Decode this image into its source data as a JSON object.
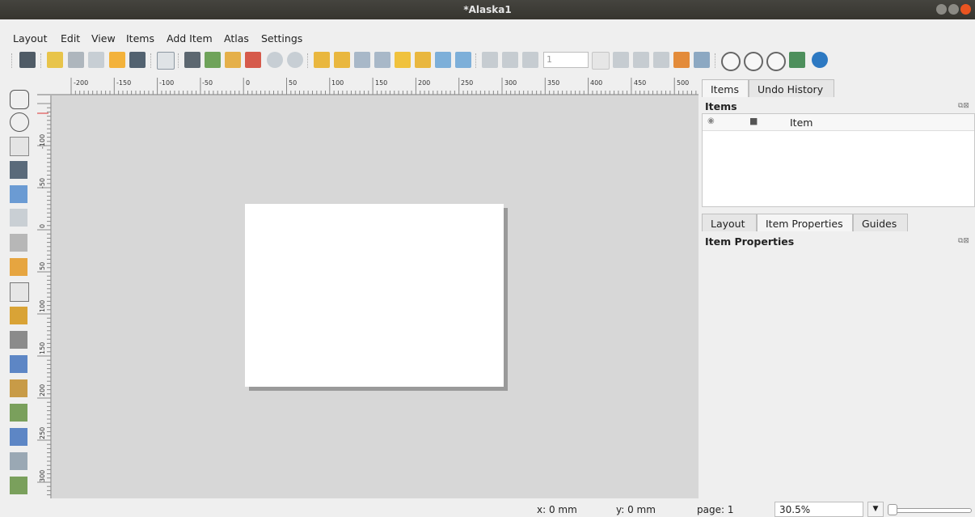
{
  "window": {
    "title": "*Alaska1"
  },
  "menu": {
    "items": [
      "Layout",
      "Edit",
      "View",
      "Items",
      "Add Item",
      "Atlas",
      "Settings"
    ]
  },
  "toolbar": {
    "page_number": "1",
    "icons": [
      "save-layout-icon",
      "new-layout-icon",
      "duplicate-layout-icon",
      "layout-manager-icon",
      "open-template-icon",
      "save-template-icon",
      "page-add-icon",
      "print-icon",
      "export-image-icon",
      "export-svg-icon",
      "export-pdf-icon",
      "undo-icon",
      "redo-icon",
      "group-icon",
      "ungroup-icon",
      "lock-icon",
      "unlock-icon",
      "raise-icon",
      "align-icon",
      "distribute-icon",
      "resize-icon",
      "atlas-preview-icon",
      "first-feature-icon",
      "prev-feature-icon",
      "next-feature-icon",
      "last-feature-icon",
      "atlas-print-icon",
      "atlas-export-icon",
      "atlas-settings-icon",
      "zoom-in-icon",
      "zoom-out-icon",
      "zoom-100-icon",
      "zoom-full-icon",
      "refresh-icon"
    ]
  },
  "rulers": {
    "top_labels": [
      "-200",
      "-150",
      "-100",
      "-50",
      "0",
      "50",
      "100",
      "150",
      "200",
      "250",
      "300",
      "350",
      "400",
      "450",
      "500"
    ],
    "left_labels": [
      "-100",
      "-50",
      "0",
      "50",
      "100",
      "150",
      "200",
      "250",
      "300"
    ]
  },
  "panels": {
    "top_tabs": [
      "Items",
      "Undo History"
    ],
    "items_title": "Items",
    "items_column": "Item",
    "bottom_tabs": [
      "Layout",
      "Item Properties",
      "Guides"
    ],
    "properties_title": "Item Properties"
  },
  "status": {
    "x": "x: 0 mm",
    "y": "y: 0 mm",
    "page": "page: 1",
    "zoom": "30.5%"
  },
  "colors": {
    "titlebar": "#3c3b37",
    "canvas": "#d7d7d7",
    "close_button": "#e95420"
  }
}
